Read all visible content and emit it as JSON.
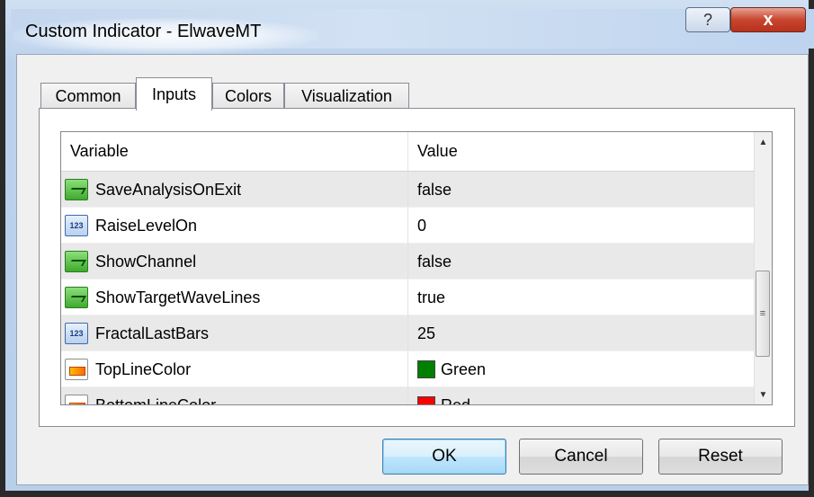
{
  "window": {
    "title": "Custom Indicator - ElwaveMT",
    "help_icon": "?",
    "close_icon": "x"
  },
  "tabs": [
    {
      "label": "Common"
    },
    {
      "label": "Inputs"
    },
    {
      "label": "Colors"
    },
    {
      "label": "Visualization"
    }
  ],
  "active_tab": "Inputs",
  "grid": {
    "headers": {
      "variable": "Variable",
      "value": "Value"
    },
    "rows": [
      {
        "icon": "bool-icon",
        "variable": "SaveAnalysisOnExit",
        "value": "false"
      },
      {
        "icon": "int-icon",
        "variable": "RaiseLevelOn",
        "value": "0"
      },
      {
        "icon": "bool-icon",
        "variable": "ShowChannel",
        "value": "false"
      },
      {
        "icon": "bool-icon",
        "variable": "ShowTargetWaveLines",
        "value": "true"
      },
      {
        "icon": "int-icon",
        "variable": "FractalLastBars",
        "value": "25"
      },
      {
        "icon": "color-icon",
        "variable": "TopLineColor",
        "value": "Green",
        "swatch": "#008000"
      },
      {
        "icon": "color-icon",
        "variable": "BottomLineColor",
        "value": "Red",
        "swatch": "#ff0000"
      }
    ],
    "int_icon_text": "123"
  },
  "buttons": {
    "ok": "OK",
    "cancel": "Cancel",
    "reset": "Reset"
  }
}
